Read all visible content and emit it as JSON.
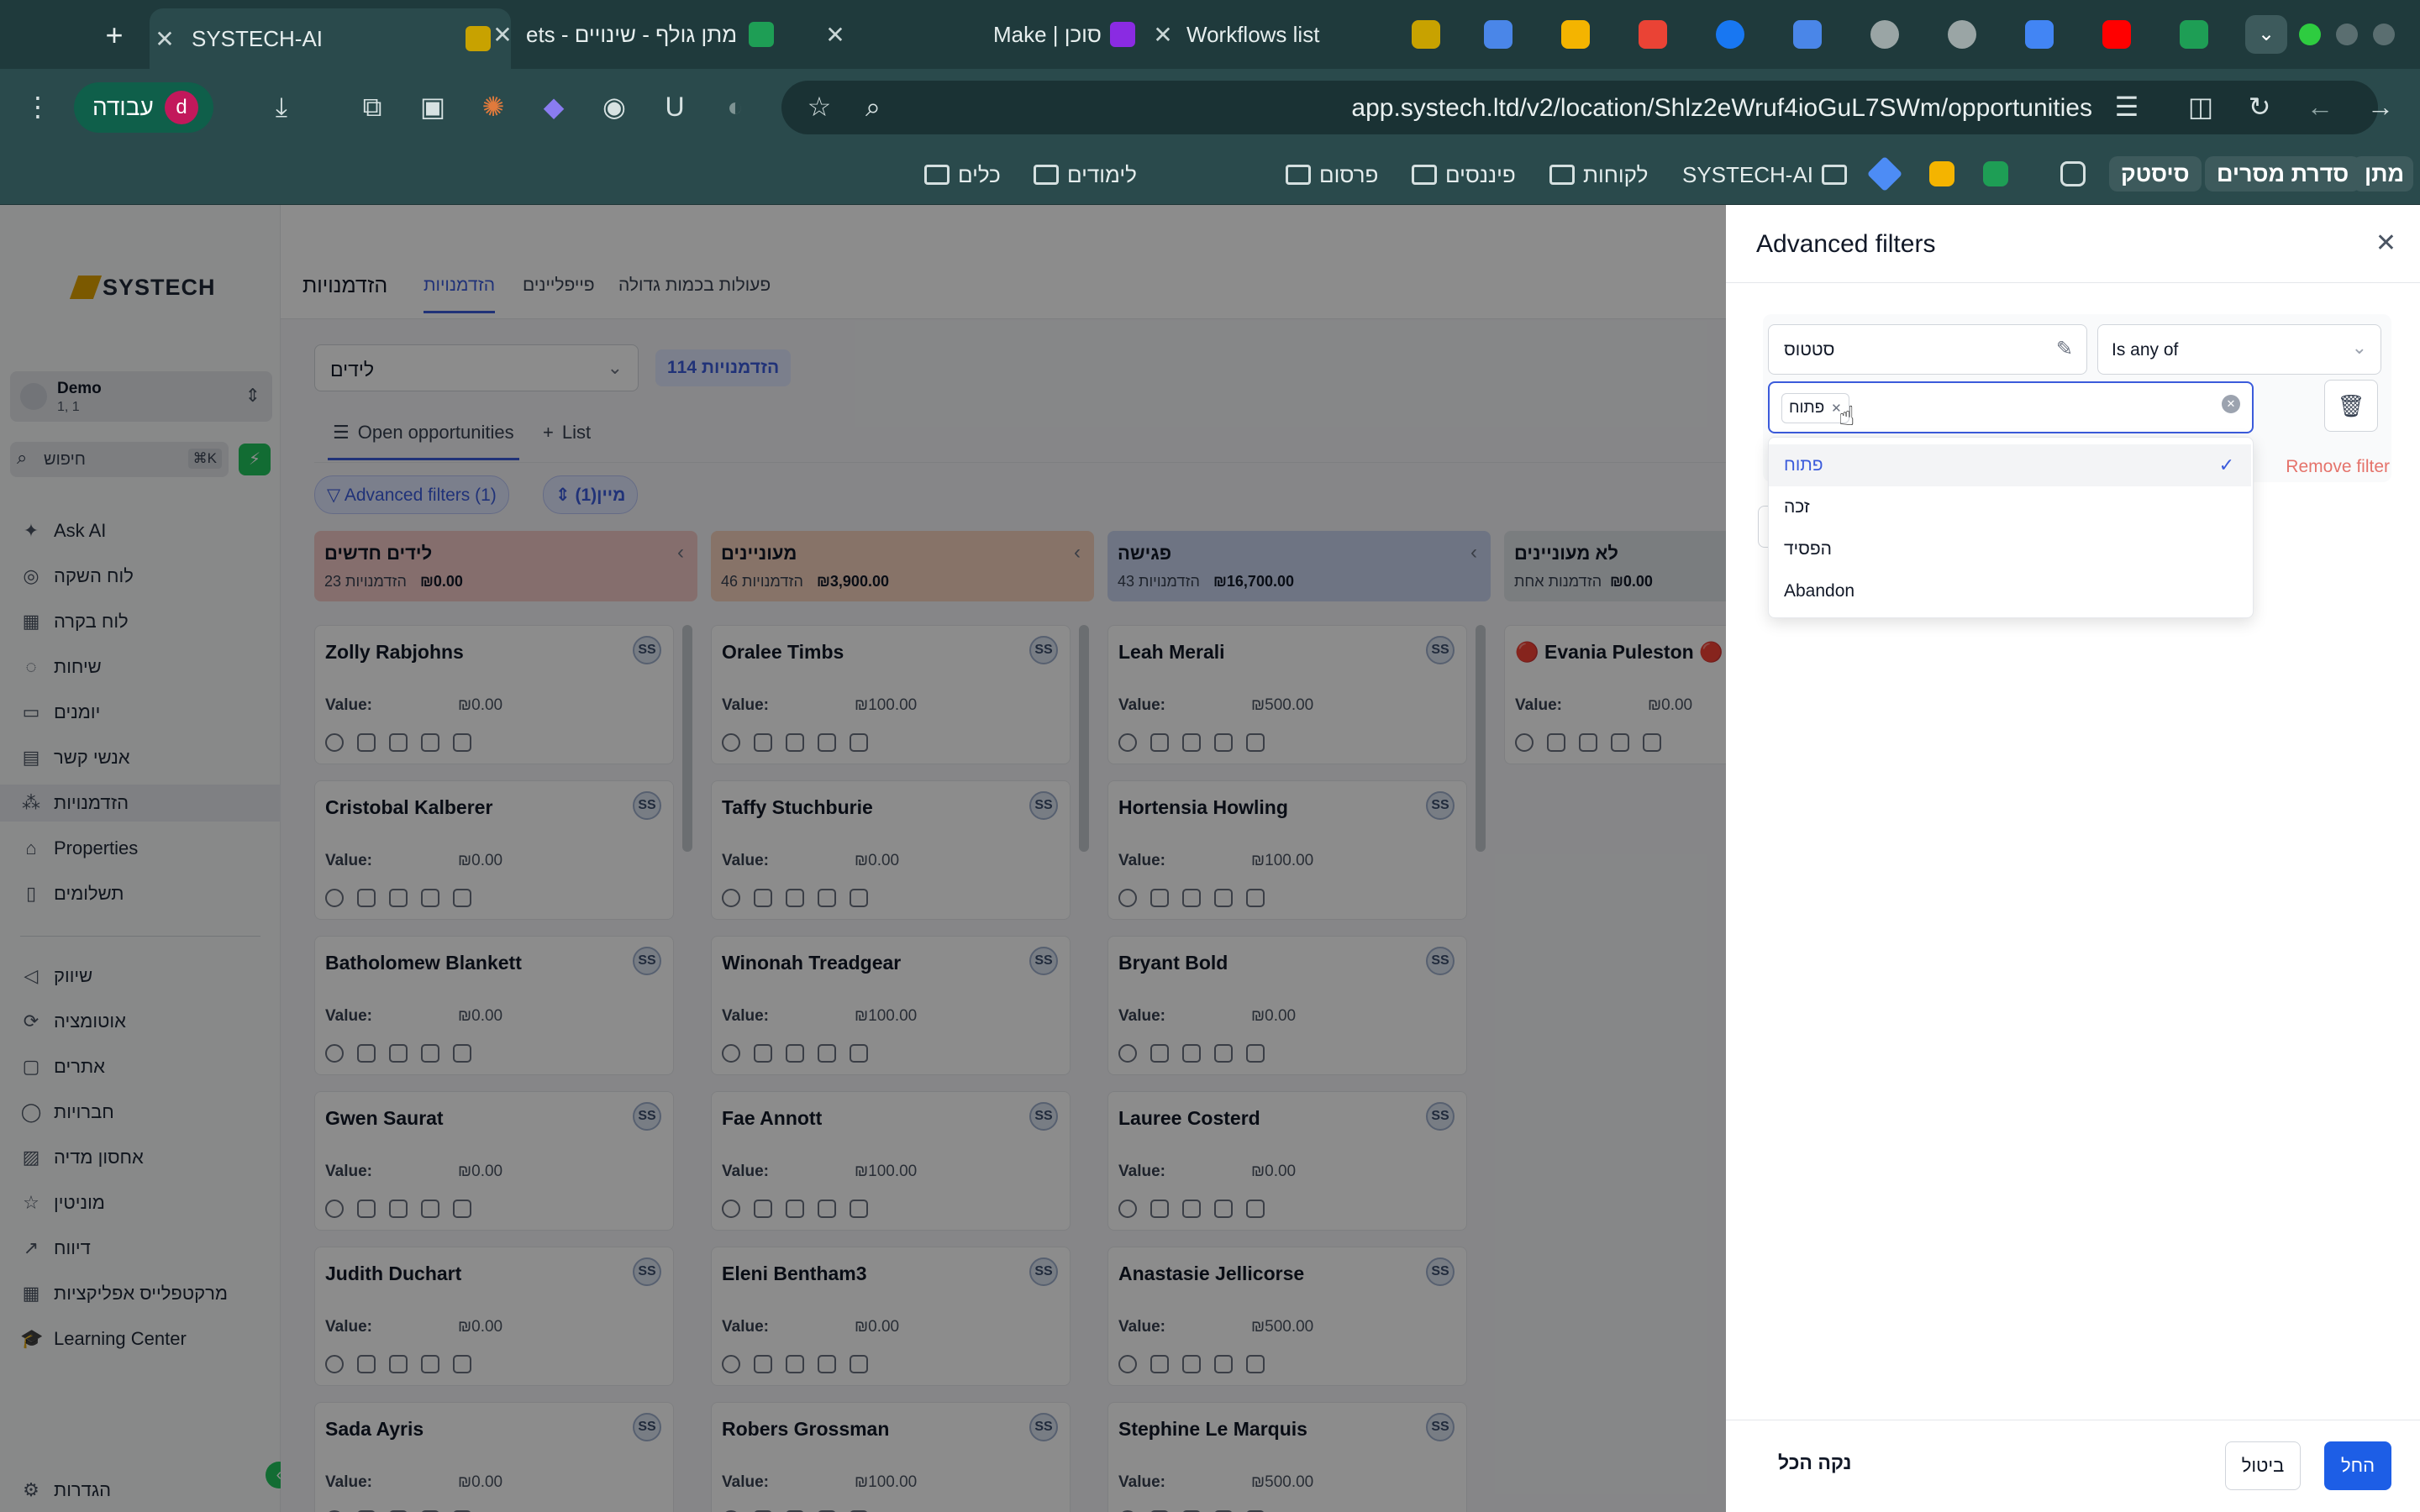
{
  "browser": {
    "tabs": [
      {
        "label": "SYSTECH-AI",
        "active": true
      },
      {
        "label": "ets - מתן גולף - שינויים"
      },
      {
        "label": "Make | סוכן"
      },
      {
        "label": "Workflows list"
      }
    ],
    "url": "app.systech.ltd/v2/location/Shlz2eWruf4ioGuL7SWm/opportunities",
    "work_profile": "עבודה",
    "avatar_letter": "d",
    "bookmarks": [
      "לימודים",
      "כלים",
      "פרסום",
      "פיננסים",
      "לקוחות",
      "SYSTECH-AI"
    ],
    "bookmark_pills": [
      "סיסטק",
      "סדרת מסרים",
      "מתן"
    ]
  },
  "sidebar": {
    "logo": "SYSTECH",
    "account_name": "Demo",
    "account_sub": "1, 1",
    "search_label": "חיפוש",
    "search_shortcut": "⌘K",
    "items": [
      {
        "label": "Ask AI",
        "icon": "sparkle-icon"
      },
      {
        "label": "לוח השקה",
        "icon": "rocket-icon"
      },
      {
        "label": "לוח בקרה",
        "icon": "dashboard-icon"
      },
      {
        "label": "שיחות",
        "icon": "chat-icon"
      },
      {
        "label": "יומנים",
        "icon": "calendar-icon"
      },
      {
        "label": "אנשי קשר",
        "icon": "contacts-icon"
      },
      {
        "label": "הזדמנויות",
        "icon": "opportunities-icon",
        "active": true
      },
      {
        "label": "Properties",
        "icon": "home-icon"
      },
      {
        "label": "תשלומים",
        "icon": "payments-icon"
      },
      {
        "label": "שיווק",
        "icon": "megaphone-icon"
      },
      {
        "label": "אוטומציה",
        "icon": "automation-icon"
      },
      {
        "label": "אתרים",
        "icon": "globe-icon"
      },
      {
        "label": "חברויות",
        "icon": "membership-icon"
      },
      {
        "label": "אחסון מדיה",
        "icon": "media-icon"
      },
      {
        "label": "מוניטין",
        "icon": "star-icon"
      },
      {
        "label": "דיווח",
        "icon": "chart-icon"
      },
      {
        "label": "מרקטפלייס אפליקציות",
        "icon": "apps-icon"
      },
      {
        "label": "Learning Center",
        "icon": "graduation-icon"
      }
    ],
    "settings_label": "הגדרות"
  },
  "main": {
    "page_title": "הזדמנויות",
    "tabs": [
      "הזדמנויות",
      "פייפליינים",
      "פעולות בכמות גדולה"
    ],
    "pipeline_select": "לידים",
    "count_badge": "114 הזדמנויות",
    "view_tabs": [
      "Open opportunities",
      "List"
    ],
    "advanced_filters_btn": "Advanced filters (1)",
    "sort_btn": "מיין(1)",
    "columns": [
      {
        "title": "לידים חדשים",
        "count": "23 הזדמנויות",
        "total": "₪0.00",
        "color": "#f3c9c6",
        "cards": [
          {
            "name": "Zolly Rabjohns",
            "value": "₪0.00"
          },
          {
            "name": "Cristobal Kalberer",
            "value": "₪0.00"
          },
          {
            "name": "Batholomew Blankett",
            "value": "₪0.00"
          },
          {
            "name": "Gwen Saurat",
            "value": "₪0.00"
          },
          {
            "name": "Judith Duchart",
            "value": "₪0.00"
          },
          {
            "name": "Sada Ayris",
            "value": "₪0.00"
          }
        ]
      },
      {
        "title": "מעוניינים",
        "count": "46 הזדמנויות",
        "total": "₪3,900.00",
        "color": "#f6d2bd",
        "cards": [
          {
            "name": "Oralee Timbs",
            "value": "₪100.00"
          },
          {
            "name": "Taffy Stuchburie",
            "value": "₪0.00"
          },
          {
            "name": "Winonah Treadgear",
            "value": "₪100.00"
          },
          {
            "name": "Fae Annott",
            "value": "₪100.00"
          },
          {
            "name": "Eleni Bentham3",
            "value": "₪0.00"
          },
          {
            "name": "Robers Grossman",
            "value": "₪100.00"
          }
        ]
      },
      {
        "title": "פגישה",
        "count": "43 הזדמנויות",
        "total": "₪16,700.00",
        "color": "#c9d4ee",
        "cards": [
          {
            "name": "Leah Merali",
            "value": "₪500.00"
          },
          {
            "name": "Hortensia Howling",
            "value": "₪100.00"
          },
          {
            "name": "Bryant Bold",
            "value": "₪0.00"
          },
          {
            "name": "Lauree Costerd",
            "value": "₪0.00"
          },
          {
            "name": "Anastasie Jellicorse",
            "value": "₪500.00"
          },
          {
            "name": "Stephine Le Marquis",
            "value": "₪500.00"
          }
        ]
      },
      {
        "title": "לא מעוניינים",
        "count": "הזדמנות אחת",
        "total": "₪0.00",
        "color": "#dfe3e8",
        "cards": [
          {
            "name": "🔴 Evania Puleston 🔴",
            "value": "₪0.00"
          }
        ]
      }
    ],
    "value_label": "Value:",
    "owner_initials": "SS"
  },
  "panel": {
    "title": "Advanced filters",
    "field_name": "סטטוס",
    "operator": "Is any of",
    "chip": "פתוח",
    "remove_filter": "Remove filter",
    "options": [
      {
        "label": "פתוח",
        "selected": true
      },
      {
        "label": "זכה"
      },
      {
        "label": "הפסיד"
      },
      {
        "label": "Abandon"
      }
    ],
    "clear_all": "נקה הכל",
    "cancel": "ביטול",
    "apply": "החל"
  }
}
